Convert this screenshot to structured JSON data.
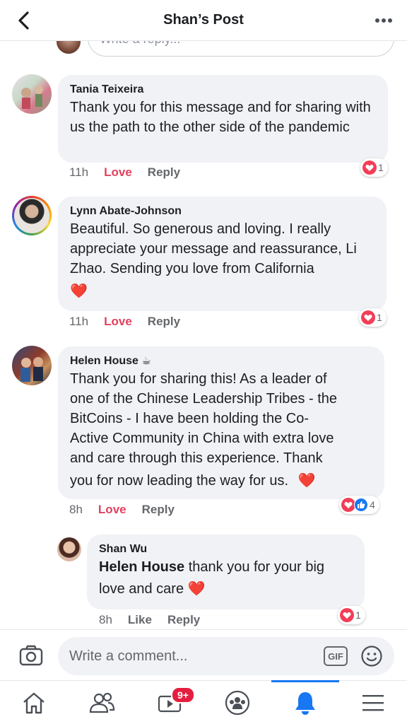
{
  "header": {
    "title": "Shan’s Post"
  },
  "partial_reply": {
    "placeholder": "Write a reply..."
  },
  "comments": [
    {
      "name": "Tania Teixeira",
      "text": "Thank you for this message and for sharing with us the path to the other side of the pandemic",
      "time": "11h",
      "action1": "Love",
      "action2": "Reply",
      "reaction_count": "1"
    },
    {
      "name": "Lynn Abate-Johnson",
      "text": "Beautiful. So generous and loving. I really appreciate your message and reassurance, Li Zhao. Sending you love from California",
      "emoji": "❤️",
      "time": "11h",
      "action1": "Love",
      "action2": "Reply",
      "reaction_count": "1"
    },
    {
      "name": "Helen House",
      "name_emoji": "☕",
      "text_line1": "Thank you for sharing this!  As a leader of",
      "text_line2": "one of the Chinese Leadership Tribes - the",
      "text_line3": "BitCoins - I have been holding the Co-",
      "text_line4": "Active Community in China with extra love",
      "text_line5": "and care through this experience.  Thank",
      "text_line6": "you for now leading the way for us.",
      "emoji": "❤️",
      "time": "8h",
      "action1": "Love",
      "action2": "Reply",
      "reaction_count": "4"
    },
    {
      "name": "Shan Wu",
      "mention": "Helen House",
      "text": " thank you for your big",
      "text2": "love and care",
      "emoji": "❤️",
      "time": "8h",
      "action1": "Like",
      "action2": "Reply",
      "reaction_count": "1"
    }
  ],
  "composer": {
    "placeholder": "Write a comment...",
    "gif_label": "GIF"
  },
  "tabbar": {
    "tabs": [
      "home-icon",
      "friends-icon",
      "watch-icon",
      "groups-icon",
      "notifications-icon",
      "menu-icon"
    ],
    "watch_badge": "9+",
    "active_color": "#1877f2"
  },
  "colors": {
    "love": "#e4405f",
    "bubble": "#f0f2f5",
    "accent": "#1877f2"
  }
}
